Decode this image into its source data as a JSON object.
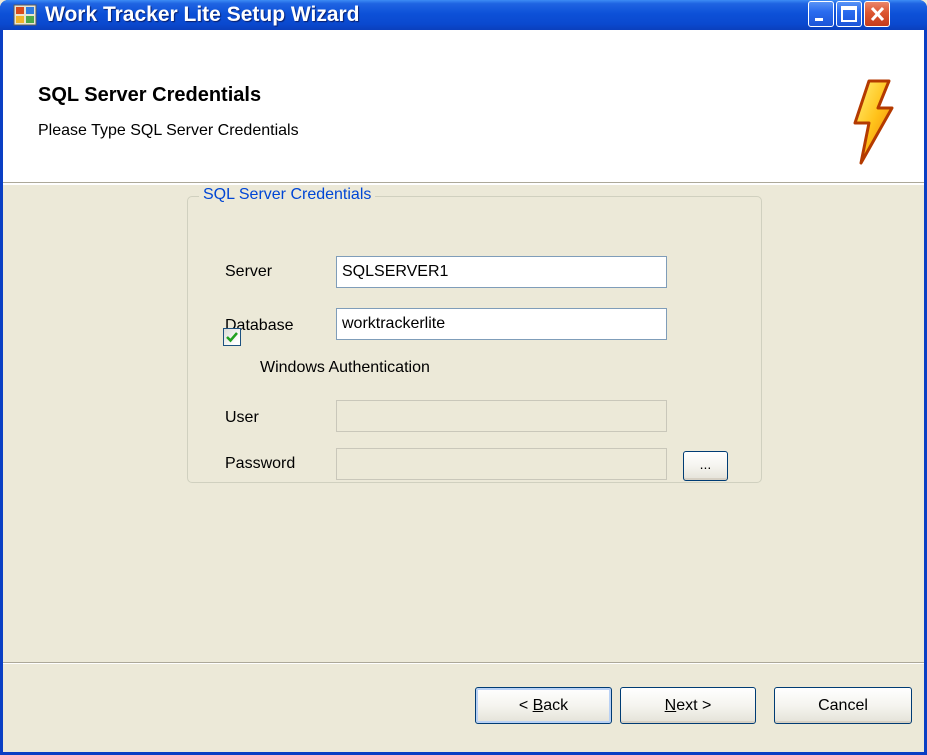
{
  "window": {
    "title": "Work Tracker Lite Setup Wizard",
    "icon": "app-window-icon",
    "controls": [
      "minimize-icon",
      "maximize-icon",
      "close-icon"
    ]
  },
  "header": {
    "title": "SQL Server Credentials",
    "subtitle": "Please Type SQL Server Credentials",
    "icon": "lightning-bolt-icon"
  },
  "group": {
    "legend": "SQL Server Credentials",
    "server_label": "Server",
    "server_value": "SQLSERVER1",
    "database_label": "Database",
    "database_value": "worktrackerlite",
    "windows_auth_label": "Windows Authentication",
    "windows_auth_checked": true,
    "user_label": "User",
    "user_value": "",
    "password_label": "Password",
    "password_value": "",
    "browse_label": "..."
  },
  "footer": {
    "back_accel": "B",
    "back_prefix": "< ",
    "back_rest": "ack",
    "next_accel": "N",
    "next_rest": "ext >",
    "cancel_label": "Cancel"
  },
  "colors": {
    "titlebar": "#0a49cf",
    "legend_text": "#0046d5",
    "face": "#ece9d8"
  }
}
